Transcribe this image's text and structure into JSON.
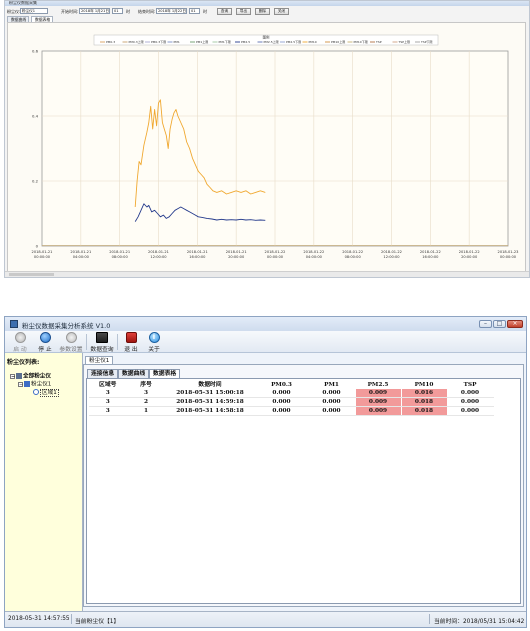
{
  "top_window": {
    "title": "粉尘仪数据采集",
    "query": {
      "device_label": "粉尘仪:",
      "device_value": "粉尘仪1",
      "start_label": "开始时间:",
      "start_date": "2018年 1月21日",
      "start_hour": "01",
      "start_unit": "时",
      "end_label": "结束时间:",
      "end_date": "2018年 1月22日",
      "end_hour": "01",
      "end_unit": "时",
      "buttons": [
        "查询",
        "导出",
        "删除",
        "关闭"
      ]
    },
    "tabs": [
      "数据曲线",
      "数据表格"
    ]
  },
  "chart_data": {
    "type": "line",
    "legend_title": "图例",
    "legend": [
      "PM0.3",
      "PM0.3上限",
      "PM0.3下限",
      "PM1",
      "PM1上限",
      "PM1下限",
      "PM2.5",
      "PM2.5上限",
      "PM2.5下限",
      "PM10",
      "PM10上限",
      "PM10下限",
      "TSP",
      "TSP上限",
      "TSP下限"
    ],
    "ylim": [
      0,
      0.6
    ],
    "yticks": [
      "0",
      "0.2",
      "0.4",
      "0.6"
    ],
    "xticks": [
      [
        "2018-01-21",
        "00:00:00"
      ],
      [
        "2018-01-21",
        "04:00:00"
      ],
      [
        "2018-01-21",
        "08:00:00"
      ],
      [
        "2018-01-21",
        "12:00:00"
      ],
      [
        "2018-01-21",
        "16:00:00"
      ],
      [
        "2018-01-21",
        "20:00:00"
      ],
      [
        "2018-01-22",
        "00:00:00"
      ],
      [
        "2018-01-22",
        "04:00:00"
      ],
      [
        "2018-01-22",
        "08:00:00"
      ],
      [
        "2018-01-22",
        "12:00:00"
      ],
      [
        "2018-01-22",
        "16:00:00"
      ],
      [
        "2018-01-22",
        "20:00:00"
      ],
      [
        "2018-01-23",
        "00:00:00"
      ]
    ],
    "series": [
      {
        "name": "PM10",
        "color": "#f0a830",
        "points": [
          [
            9.6,
            0.12
          ],
          [
            9.8,
            0.2
          ],
          [
            10.0,
            0.26
          ],
          [
            10.2,
            0.25
          ],
          [
            10.5,
            0.31
          ],
          [
            10.8,
            0.35
          ],
          [
            11.0,
            0.38
          ],
          [
            11.2,
            0.43
          ],
          [
            11.4,
            0.36
          ],
          [
            11.6,
            0.42
          ],
          [
            11.8,
            0.37
          ],
          [
            12.0,
            0.44
          ],
          [
            12.2,
            0.45
          ],
          [
            12.4,
            0.38
          ],
          [
            12.6,
            0.36
          ],
          [
            12.8,
            0.34
          ],
          [
            13.0,
            0.3
          ],
          [
            13.2,
            0.36
          ],
          [
            13.4,
            0.39
          ],
          [
            13.6,
            0.41
          ],
          [
            13.8,
            0.42
          ],
          [
            14.0,
            0.4
          ],
          [
            14.3,
            0.38
          ],
          [
            14.6,
            0.36
          ],
          [
            14.9,
            0.32
          ],
          [
            15.2,
            0.3
          ],
          [
            15.5,
            0.27
          ],
          [
            15.8,
            0.25
          ],
          [
            16.1,
            0.23
          ],
          [
            16.4,
            0.22
          ],
          [
            16.7,
            0.21
          ],
          [
            17.0,
            0.19
          ],
          [
            17.3,
            0.18
          ],
          [
            17.6,
            0.17
          ],
          [
            18.0,
            0.165
          ],
          [
            18.5,
            0.17
          ],
          [
            19.0,
            0.16
          ],
          [
            19.5,
            0.165
          ],
          [
            20.0,
            0.17
          ],
          [
            20.5,
            0.165
          ],
          [
            21.0,
            0.17
          ],
          [
            21.5,
            0.16
          ],
          [
            22.0,
            0.165
          ],
          [
            22.5,
            0.17
          ],
          [
            23.0,
            0.165
          ]
        ]
      },
      {
        "name": "PM2.5",
        "color": "#243a8c",
        "points": [
          [
            9.6,
            0.075
          ],
          [
            9.9,
            0.09
          ],
          [
            10.2,
            0.11
          ],
          [
            10.5,
            0.13
          ],
          [
            10.8,
            0.12
          ],
          [
            11.0,
            0.125
          ],
          [
            11.3,
            0.105
          ],
          [
            11.6,
            0.11
          ],
          [
            11.9,
            0.1
          ],
          [
            12.2,
            0.09
          ],
          [
            12.5,
            0.095
          ],
          [
            12.8,
            0.085
          ],
          [
            13.1,
            0.09
          ],
          [
            13.4,
            0.1
          ],
          [
            13.7,
            0.11
          ],
          [
            14.0,
            0.115
          ],
          [
            14.3,
            0.12
          ],
          [
            14.6,
            0.115
          ],
          [
            14.9,
            0.11
          ],
          [
            15.2,
            0.105
          ],
          [
            15.5,
            0.1
          ],
          [
            15.8,
            0.095
          ],
          [
            16.1,
            0.09
          ],
          [
            16.5,
            0.088
          ],
          [
            17.0,
            0.085
          ],
          [
            17.5,
            0.083
          ],
          [
            18.0,
            0.08
          ],
          [
            18.5,
            0.082
          ],
          [
            19.0,
            0.08
          ],
          [
            19.5,
            0.081
          ],
          [
            20.0,
            0.08
          ],
          [
            20.5,
            0.082
          ],
          [
            21.0,
            0.08
          ],
          [
            21.5,
            0.081
          ],
          [
            22.0,
            0.079
          ],
          [
            22.5,
            0.08
          ],
          [
            23.0,
            0.079
          ]
        ]
      }
    ]
  },
  "app": {
    "title": "粉尘仪数据采集分析系统 V1.0",
    "toolbar": [
      {
        "label": "启 动",
        "icon": "play-icon"
      },
      {
        "label": "停 止",
        "icon": "stop-icon"
      },
      {
        "label": "参数设置",
        "icon": "settings-icon"
      },
      {
        "label": "数据查询",
        "icon": "data-query-icon"
      },
      {
        "label": "退 出",
        "icon": "power-icon"
      },
      {
        "label": "关于",
        "icon": "info-icon"
      }
    ],
    "left_panel": {
      "title": "粉尘仪列表:",
      "tree": [
        {
          "label": "全部粉尘仪",
          "level": 0
        },
        {
          "label": "粉尘仪1",
          "level": 1
        },
        {
          "label": "区域1",
          "level": 2
        }
      ]
    },
    "outer_tab": "粉尘仪1",
    "inner_tabs": [
      "连接信息",
      "数据曲线",
      "数据表格"
    ],
    "table": {
      "columns": [
        "区域号",
        "序号",
        "数据时间",
        "PM0.3",
        "PM1",
        "PM2.5",
        "PM10",
        "TSP"
      ],
      "rows": [
        [
          "3",
          "3",
          "2018-05-31 15:00:18",
          "0.000",
          "0.000",
          "0.009",
          "0.016",
          "0.000"
        ],
        [
          "3",
          "2",
          "2018-05-31 14:59:18",
          "0.000",
          "0.000",
          "0.009",
          "0.018",
          "0.000"
        ],
        [
          "3",
          "1",
          "2018-05-31 14:58:18",
          "0.000",
          "0.000",
          "0.009",
          "0.018",
          "0.000"
        ]
      ]
    },
    "status": {
      "datetime": "2018-05-31 14:57:55",
      "current_device": "当前粉尘仪【1】",
      "current_time": "当前时间：2018/05/31 15:04:42"
    }
  }
}
